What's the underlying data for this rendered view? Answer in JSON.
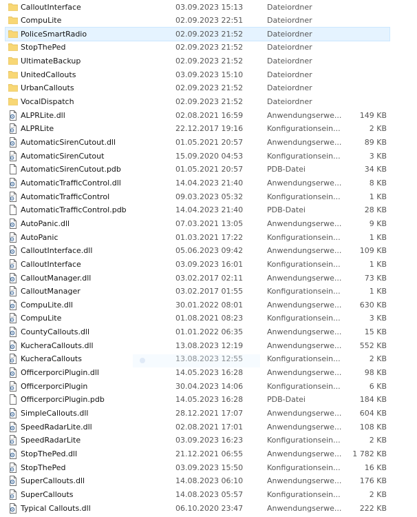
{
  "colors": {
    "folder": "#f8d775",
    "folder_dark": "#e0b84a",
    "selection_bg": "#e5f3ff",
    "selection_border": "#cce8ff",
    "dll_icon_border": "#6a6a6a",
    "gear": "#5a7fa8"
  },
  "rows": [
    {
      "name": "CalloutInterface",
      "date": "03.09.2023 15:13",
      "type": "Dateiordner",
      "size": "",
      "icon": "folder-icon"
    },
    {
      "name": "CompuLite",
      "date": "02.09.2023 22:51",
      "type": "Dateiordner",
      "size": "",
      "icon": "folder-icon"
    },
    {
      "name": "PoliceSmartRadio",
      "date": "02.09.2023 21:52",
      "type": "Dateiordner",
      "size": "",
      "icon": "folder-icon",
      "selected": true
    },
    {
      "name": "StopThePed",
      "date": "02.09.2023 21:52",
      "type": "Dateiordner",
      "size": "",
      "icon": "folder-icon"
    },
    {
      "name": "UltimateBackup",
      "date": "02.09.2023 21:52",
      "type": "Dateiordner",
      "size": "",
      "icon": "folder-icon"
    },
    {
      "name": "UnitedCallouts",
      "date": "03.09.2023 15:10",
      "type": "Dateiordner",
      "size": "",
      "icon": "folder-icon"
    },
    {
      "name": "UrbanCallouts",
      "date": "02.09.2023 21:52",
      "type": "Dateiordner",
      "size": "",
      "icon": "folder-icon"
    },
    {
      "name": "VocalDispatch",
      "date": "02.09.2023 21:52",
      "type": "Dateiordner",
      "size": "",
      "icon": "folder-icon"
    },
    {
      "name": "ALPRLite.dll",
      "date": "02.08.2021 16:59",
      "type": "Anwendungserwe...",
      "size": "149 KB",
      "icon": "dll-file-icon"
    },
    {
      "name": "ALPRLite",
      "date": "22.12.2017 19:16",
      "type": "Konfigurationsein...",
      "size": "2 KB",
      "icon": "config-file-icon"
    },
    {
      "name": "AutomaticSirenCutout.dll",
      "date": "01.05.2021 20:57",
      "type": "Anwendungserwe...",
      "size": "89 KB",
      "icon": "dll-file-icon"
    },
    {
      "name": "AutomaticSirenCutout",
      "date": "15.09.2020 04:53",
      "type": "Konfigurationsein...",
      "size": "3 KB",
      "icon": "config-file-icon"
    },
    {
      "name": "AutomaticSirenCutout.pdb",
      "date": "01.05.2021 20:57",
      "type": "PDB-Datei",
      "size": "34 KB",
      "icon": "blank-file-icon"
    },
    {
      "name": "AutomaticTrafficControl.dll",
      "date": "14.04.2023 21:40",
      "type": "Anwendungserwe...",
      "size": "8 KB",
      "icon": "dll-file-icon"
    },
    {
      "name": "AutomaticTrafficControl",
      "date": "09.03.2023 05:32",
      "type": "Konfigurationsein...",
      "size": "1 KB",
      "icon": "config-file-icon"
    },
    {
      "name": "AutomaticTrafficControl.pdb",
      "date": "14.04.2023 21:40",
      "type": "PDB-Datei",
      "size": "28 KB",
      "icon": "blank-file-icon"
    },
    {
      "name": "AutoPanic.dll",
      "date": "07.03.2021 13:05",
      "type": "Anwendungserwe...",
      "size": "9 KB",
      "icon": "dll-file-icon"
    },
    {
      "name": "AutoPanic",
      "date": "01.03.2021 17:22",
      "type": "Konfigurationsein...",
      "size": "1 KB",
      "icon": "config-file-icon"
    },
    {
      "name": "CalloutInterface.dll",
      "date": "05.06.2023 09:42",
      "type": "Anwendungserwe...",
      "size": "109 KB",
      "icon": "dll-file-icon"
    },
    {
      "name": "CalloutInterface",
      "date": "03.09.2023 16:01",
      "type": "Konfigurationsein...",
      "size": "1 KB",
      "icon": "config-file-icon"
    },
    {
      "name": "CalloutManager.dll",
      "date": "03.02.2017 02:11",
      "type": "Anwendungserwe...",
      "size": "73 KB",
      "icon": "dll-file-icon"
    },
    {
      "name": "CalloutManager",
      "date": "03.02.2017 01:55",
      "type": "Konfigurationsein...",
      "size": "1 KB",
      "icon": "config-file-icon"
    },
    {
      "name": "CompuLite.dll",
      "date": "30.01.2022 08:01",
      "type": "Anwendungserwe...",
      "size": "630 KB",
      "icon": "dll-file-icon"
    },
    {
      "name": "CompuLite",
      "date": "01.08.2021 08:23",
      "type": "Konfigurationsein...",
      "size": "3 KB",
      "icon": "config-file-icon"
    },
    {
      "name": "CountyCallouts.dll",
      "date": "01.01.2022 06:35",
      "type": "Anwendungserwe...",
      "size": "15 KB",
      "icon": "dll-file-icon"
    },
    {
      "name": "KucheraCallouts.dll",
      "date": "13.08.2023 12:19",
      "type": "Anwendungserwe...",
      "size": "552 KB",
      "icon": "dll-file-icon"
    },
    {
      "name": "KucheraCallouts",
      "date": "13.08.2023 12:55",
      "type": "Konfigurationsein...",
      "size": "2 KB",
      "icon": "config-file-icon"
    },
    {
      "name": "OfficerporciPlugin.dll",
      "date": "14.05.2023 16:28",
      "type": "Anwendungserwe...",
      "size": "98 KB",
      "icon": "dll-file-icon"
    },
    {
      "name": "OfficerporciPlugin",
      "date": "30.04.2023 14:06",
      "type": "Konfigurationsein...",
      "size": "6 KB",
      "icon": "config-file-icon"
    },
    {
      "name": "OfficerporciPlugin.pdb",
      "date": "14.05.2023 16:28",
      "type": "PDB-Datei",
      "size": "184 KB",
      "icon": "blank-file-icon"
    },
    {
      "name": "SimpleCallouts.dll",
      "date": "28.12.2021 17:07",
      "type": "Anwendungserwe...",
      "size": "604 KB",
      "icon": "dll-file-icon"
    },
    {
      "name": "SpeedRadarLite.dll",
      "date": "02.08.2021 17:01",
      "type": "Anwendungserwe...",
      "size": "108 KB",
      "icon": "dll-file-icon"
    },
    {
      "name": "SpeedRadarLite",
      "date": "03.09.2023 16:23",
      "type": "Konfigurationsein...",
      "size": "2 KB",
      "icon": "config-file-icon"
    },
    {
      "name": "StopThePed.dll",
      "date": "21.12.2021 06:55",
      "type": "Anwendungserwe...",
      "size": "1 782 KB",
      "icon": "dll-file-icon"
    },
    {
      "name": "StopThePed",
      "date": "03.09.2023 15:50",
      "type": "Konfigurationsein...",
      "size": "16 KB",
      "icon": "config-file-icon"
    },
    {
      "name": "SuperCallouts.dll",
      "date": "14.08.2023 06:10",
      "type": "Anwendungserwe...",
      "size": "176 KB",
      "icon": "dll-file-icon"
    },
    {
      "name": "SuperCallouts",
      "date": "14.08.2023 05:57",
      "type": "Konfigurationsein...",
      "size": "2 KB",
      "icon": "config-file-icon"
    },
    {
      "name": "Typical Callouts.dll",
      "date": "06.10.2020 23:47",
      "type": "Anwendungserwe...",
      "size": "222 KB",
      "icon": "dll-file-icon"
    }
  ]
}
